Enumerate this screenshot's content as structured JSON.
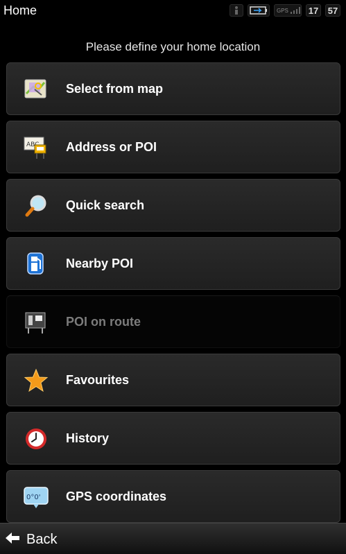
{
  "status_bar": {
    "title": "Home",
    "gps_label": "GPS",
    "hour": "17",
    "minute": "57"
  },
  "prompt": "Please define your home location",
  "menu": [
    {
      "label": "Select from map",
      "icon": "map-select-icon",
      "enabled": true
    },
    {
      "label": "Address or POI",
      "icon": "address-sign-icon",
      "enabled": true
    },
    {
      "label": "Quick search",
      "icon": "magnifier-icon",
      "enabled": true
    },
    {
      "label": "Nearby POI",
      "icon": "fuel-pump-icon",
      "enabled": true
    },
    {
      "label": "POI on route",
      "icon": "poi-on-route-icon",
      "enabled": false
    },
    {
      "label": "Favourites",
      "icon": "star-icon",
      "enabled": true
    },
    {
      "label": "History",
      "icon": "history-clock-icon",
      "enabled": true
    },
    {
      "label": "GPS coordinates",
      "icon": "gps-coordinates-icon",
      "enabled": true
    }
  ],
  "gps_badge_text": "0°0'",
  "back": {
    "label": "Back"
  },
  "colors": {
    "background": "#000000",
    "item": "#262626",
    "disabled_text": "#7c7c7c",
    "star": "#f39a1a",
    "pump": "#1e73d6",
    "clock": "#d42a2a"
  }
}
